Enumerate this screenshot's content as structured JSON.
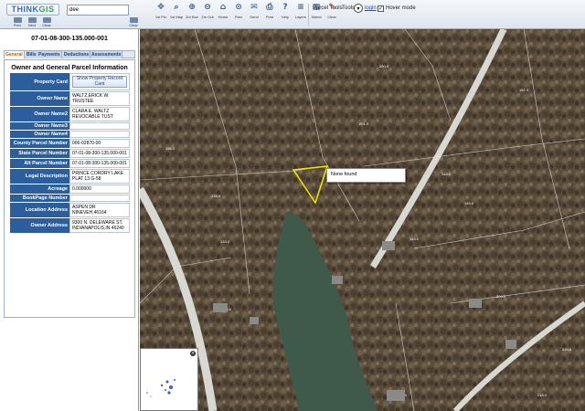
{
  "toolbar": {
    "logo_think": "THINK",
    "logo_gis": "GIS",
    "search_value": "dee",
    "small_buttons": [
      "Prev",
      "Next",
      "Clear"
    ],
    "tools": [
      "1st Pin",
      "1st Map",
      "Zm Box",
      "Zm Out",
      "Home",
      "Prev",
      "Send",
      "Print",
      "Help",
      "Layers",
      "Select",
      "Clear"
    ],
    "parcel_tools": "Parcel Tools",
    "tools_label": "Tools",
    "login": "login",
    "hover_mode": "Hover mode"
  },
  "panel": {
    "parcel_id": "07-01-08-300-135.000-001",
    "tabs": [
      "General",
      "Bills",
      "Payments",
      "Deductions",
      "Assessments"
    ],
    "section_title": "Owner and General Parcel Information",
    "property_card_button": "Show Property Record Card",
    "rows": [
      {
        "label": "Property Card",
        "value": ""
      },
      {
        "label": "Owner Name",
        "value": "WALTZ,ERICK W. TRUSTEE"
      },
      {
        "label": "Owner Name2",
        "value": "CLARA E. WALTZ REVOCABLE TUST"
      },
      {
        "label": "Owner Name3",
        "value": ""
      },
      {
        "label": "Owner Name4",
        "value": ""
      },
      {
        "label": "County Parcel Number",
        "value": "006-02870-00"
      },
      {
        "label": "State Parcel Number",
        "value": "07-01-08-300-135.000-001"
      },
      {
        "label": "Alt Parcel Number",
        "value": "07-01-08-300-135.000-001"
      },
      {
        "label": "Legal Description",
        "value": "PRINCE CORDRY LAKE PLAT 13 G-58"
      },
      {
        "label": "Acreage",
        "value": "0.000000"
      },
      {
        "label": "BookPage Number",
        "value": ""
      },
      {
        "label": "Location Address",
        "value": "ASPEN DR NINEVEH,46164"
      },
      {
        "label": "Owner Address",
        "value": "9300 N. DELEWARE ST. INDIANAPOLIS,IN 46240"
      }
    ]
  },
  "map": {
    "popup_text": "None found",
    "parcel_labels": [
      "200.0",
      "201.0",
      "152.0",
      "196.0",
      "138.0",
      "133.0",
      "143.0",
      "144.0",
      "145.0",
      "203.0",
      "200.0",
      "290.0",
      "215.0",
      "239.0"
    ]
  },
  "colors": {
    "label_bg": "#2c5d9c",
    "selection": "#f2e600"
  }
}
